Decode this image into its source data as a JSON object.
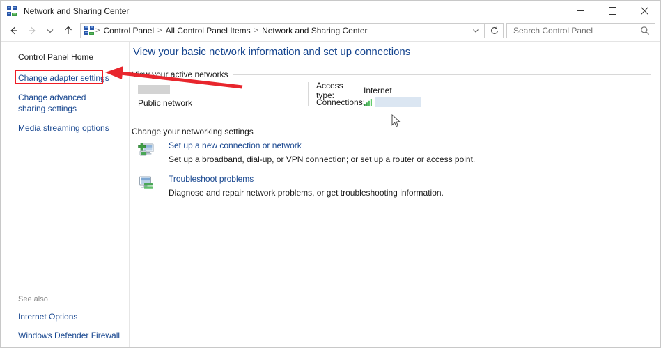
{
  "window": {
    "title": "Network and Sharing Center",
    "icon": "network-sharing-icon",
    "controls": {
      "minimize": "minimize-button",
      "maximize": "maximize-button",
      "close": "close-button"
    }
  },
  "navbar": {
    "back": "back-arrow-icon",
    "forward": "forward-arrow-icon",
    "recent": "chevron-down-icon",
    "up": "up-arrow-icon",
    "breadcrumb": [
      "Control Panel",
      "All Control Panel Items",
      "Network and Sharing Center"
    ],
    "separator": ">",
    "dropdown": "chevron-down-icon",
    "refresh": "refresh-icon"
  },
  "search": {
    "placeholder": "Search Control Panel",
    "value": "",
    "icon": "search-icon"
  },
  "sidebar": {
    "items": [
      {
        "label": "Control Panel Home",
        "highlighted": false
      },
      {
        "label": "Change adapter settings",
        "highlighted": true
      },
      {
        "label": "Change advanced sharing settings",
        "highlighted": false
      },
      {
        "label": "Media streaming options",
        "highlighted": false
      }
    ],
    "see_also": {
      "title": "See also",
      "items": [
        "Internet Options",
        "Windows Defender Firewall"
      ]
    }
  },
  "main": {
    "page_title": "View your basic network information and set up connections",
    "sections": {
      "active_networks": "View your active networks",
      "networking_settings": "Change your networking settings"
    },
    "active_network": {
      "name_redacted": true,
      "network_type": "Public network",
      "details": [
        {
          "key": "Access type:",
          "value": "Internet",
          "redacted": false
        },
        {
          "key": "Connections:",
          "value": "",
          "redacted": true,
          "icon": "signal-bars-icon"
        }
      ]
    },
    "tasks": [
      {
        "icon": "new-connection-icon",
        "link": "Set up a new connection or network",
        "description": "Set up a broadband, dial-up, or VPN connection; or set up a router or access point."
      },
      {
        "icon": "troubleshoot-icon",
        "link": "Troubleshoot problems",
        "description": "Diagnose and repair network problems, or get troubleshooting information."
      }
    ]
  },
  "annotations": {
    "highlight_color": "#ee1c25",
    "arrow_color": "#e8262d",
    "highlight_target": "Change adapter settings",
    "cursor": "mouse-pointer"
  },
  "colors": {
    "link": "#17468f",
    "text": "#1b1b1b",
    "muted": "#8a8a8a",
    "redact_gray": "#d3d3d3",
    "redact_blue": "#dbe6f2"
  }
}
